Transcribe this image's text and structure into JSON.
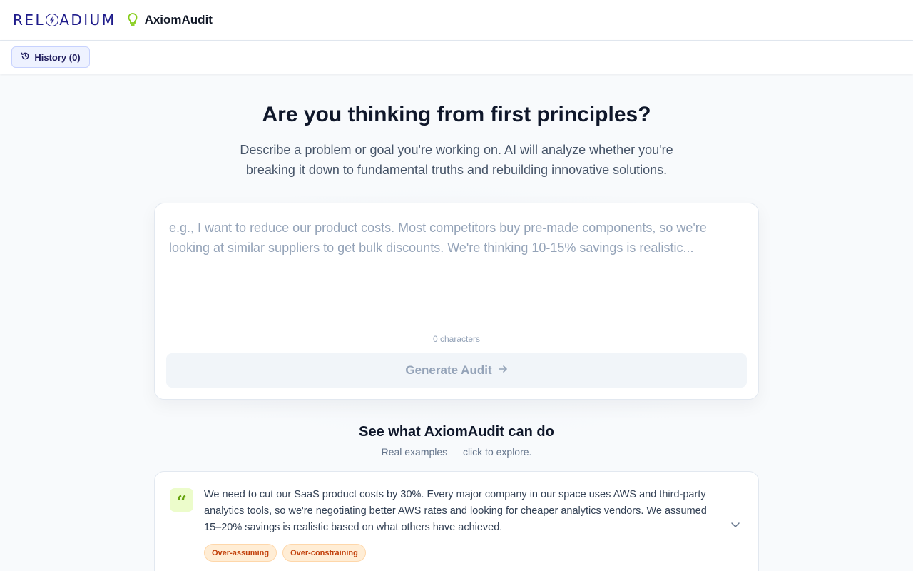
{
  "header": {
    "logo_icon": "reloadium-logo",
    "bulb_icon": "lightbulb-icon",
    "app_name": "AxiomAudit"
  },
  "toolbar": {
    "history_label": "History (0)",
    "history_icon": "history-icon"
  },
  "hero": {
    "title": "Are you thinking from first principles?",
    "subtitle": "Describe a problem or goal you're working on. AI will analyze whether you're breaking it down to fundamental truths and rebuilding innovative solutions."
  },
  "input": {
    "value": "",
    "placeholder": "e.g., I want to reduce our product costs. Most competitors buy pre-made components, so we're looking at similar suppliers to get bulk discounts. We're thinking 10-15% savings is realistic...",
    "char_count": "0 characters",
    "submit_label": "Generate Audit",
    "submit_icon": "arrow-right-icon"
  },
  "examples": {
    "title": "See what AxiomAudit can do",
    "subtitle": "Real examples — click to explore.",
    "items": [
      {
        "icon": "quote-icon",
        "text": "We need to cut our SaaS product costs by 30%. Every major company in our space uses AWS and third-party analytics tools, so we're negotiating better AWS rates and looking for cheaper analytics vendors. We assumed 15–20% savings is realistic based on what others have achieved.",
        "tags": [
          "Over-assuming",
          "Over-constraining"
        ],
        "expand_icon": "chevron-down-icon"
      }
    ]
  },
  "colors": {
    "brand": "#1e1b8a",
    "accent_green": "#84cc16",
    "tag_orange": "#c2410c"
  }
}
